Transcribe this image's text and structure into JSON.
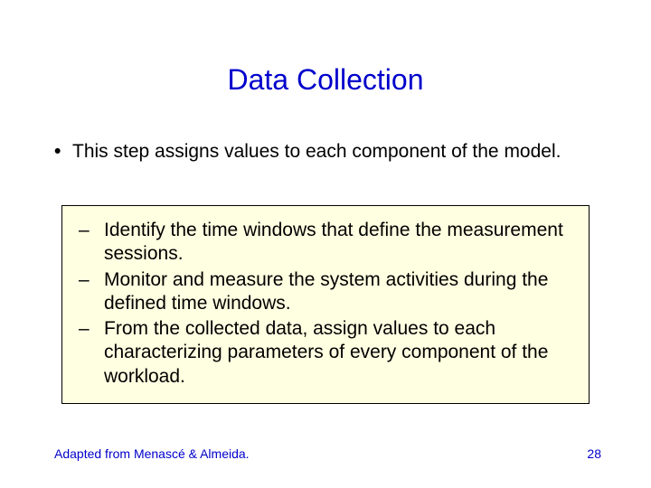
{
  "title": "Data Collection",
  "mainBullet": "This step assigns values to each component of the model.",
  "subBullets": [
    "Identify the time windows that define the measurement sessions.",
    "Monitor and measure the system activities during the defined time windows.",
    "From the collected data, assign values to each characterizing parameters of every component of the workload."
  ],
  "footerLeft": "Adapted from Menascé & Almeida.",
  "pageNumber": "28"
}
